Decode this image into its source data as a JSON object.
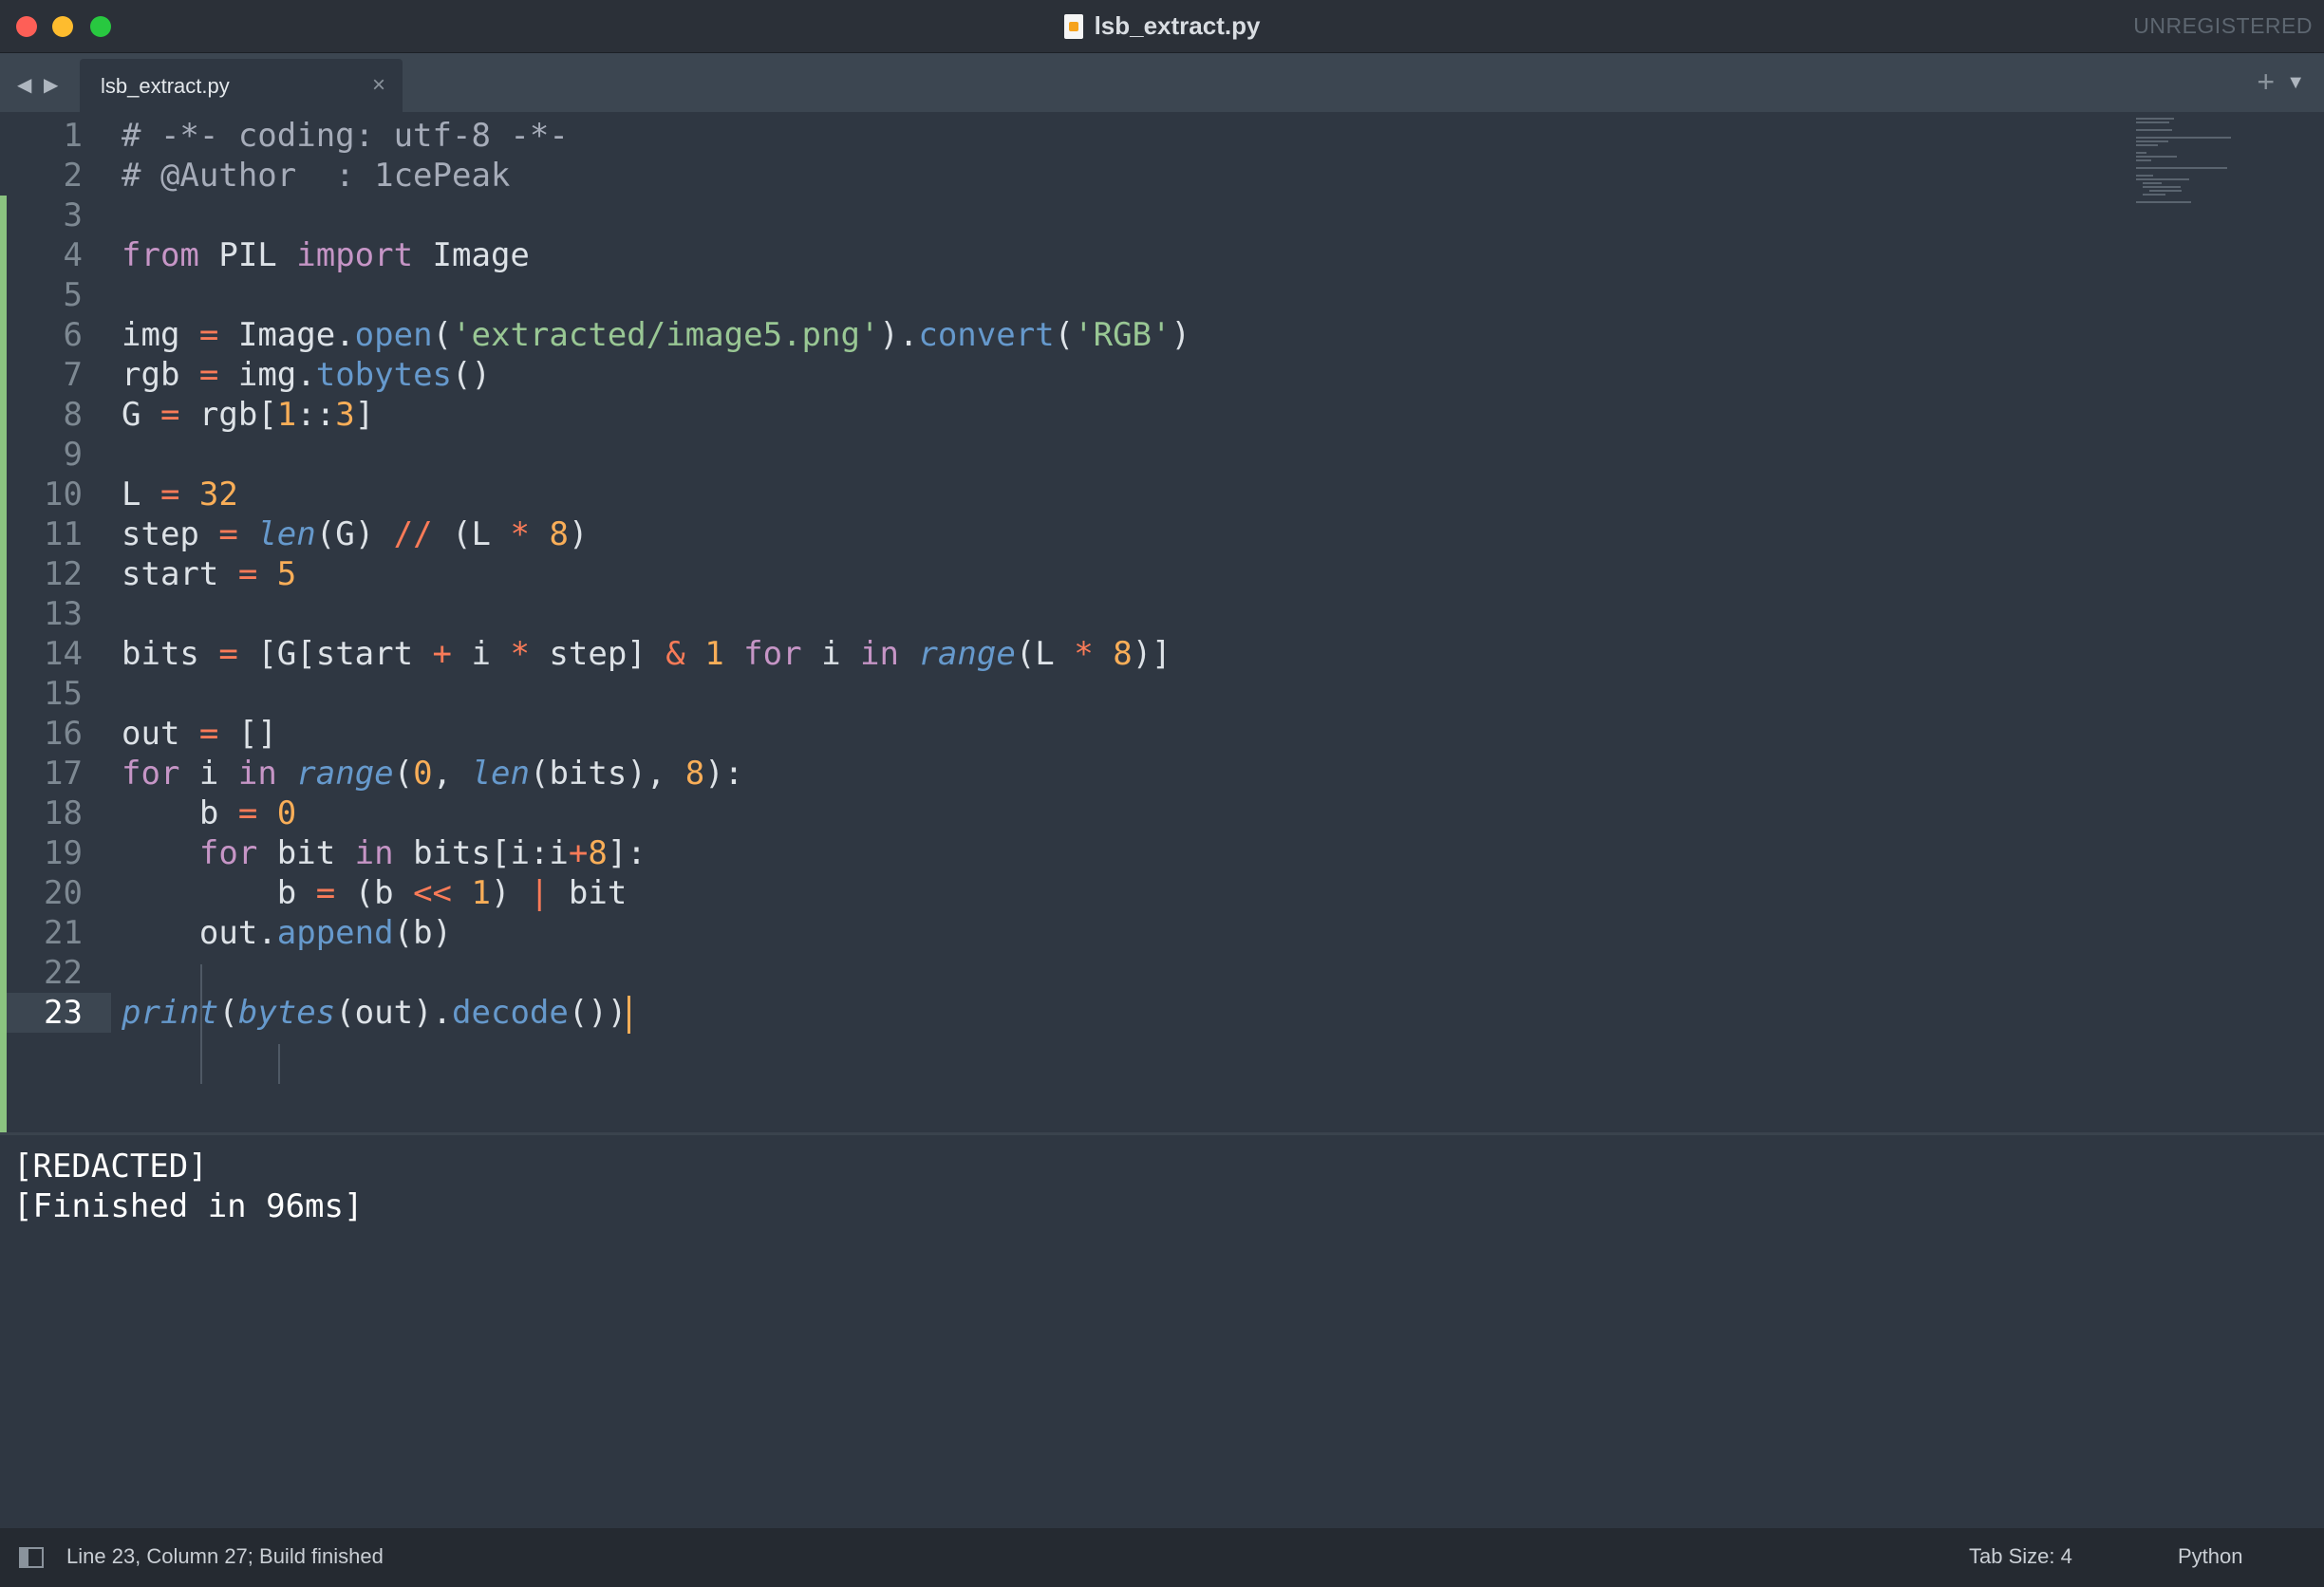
{
  "window": {
    "title": "lsb_extract.py",
    "license_notice": "UNREGISTERED"
  },
  "tabs": [
    {
      "label": "lsb_extract.py",
      "active": true
    }
  ],
  "icons": {
    "close": "close-window-icon",
    "minimize": "minimize-window-icon",
    "zoom": "zoom-window-icon",
    "file": "python-file-icon",
    "nav_back": "chevron-left-icon",
    "nav_forward": "chevron-right-icon",
    "tab_close": "close-icon",
    "new_tab": "plus-icon",
    "tab_menu": "chevron-down-icon",
    "panel": "panel-toggle-icon"
  },
  "editor": {
    "line_numbers": [
      "1",
      "2",
      "3",
      "4",
      "5",
      "6",
      "7",
      "8",
      "9",
      "10",
      "11",
      "12",
      "13",
      "14",
      "15",
      "16",
      "17",
      "18",
      "19",
      "20",
      "21",
      "22",
      "23"
    ],
    "active_line": "23",
    "lines": [
      "# -*- coding: utf-8 -*-",
      "# @Author  : 1cePeak",
      "",
      "from PIL import Image",
      "",
      "img = Image.open('extracted/image5.png').convert('RGB')",
      "rgb = img.tobytes()",
      "G = rgb[1::3]",
      "",
      "L = 32",
      "step = len(G) // (L * 8)",
      "start = 5",
      "",
      "bits = [G[start + i * step] & 1 for i in range(L * 8)]",
      "",
      "out = []",
      "for i in range(0, len(bits), 8):",
      "    b = 0",
      "    for bit in bits[i:i+8]:",
      "        b = (b << 1) | bit",
      "    out.append(b)",
      "",
      "print(bytes(out).decode())"
    ]
  },
  "output": {
    "lines": [
      "[REDACTED]",
      "[Finished in 96ms]"
    ]
  },
  "status": {
    "position": "Line 23, Column 27; Build finished",
    "tab_size": "Tab Size: 4",
    "syntax": "Python"
  },
  "colors": {
    "background": "#2f3742",
    "keyword": "#c695c6",
    "operator": "#f97b58",
    "number": "#f9ae58",
    "string": "#99c794",
    "function": "#6699cc",
    "changed_line": "#8bc380"
  }
}
